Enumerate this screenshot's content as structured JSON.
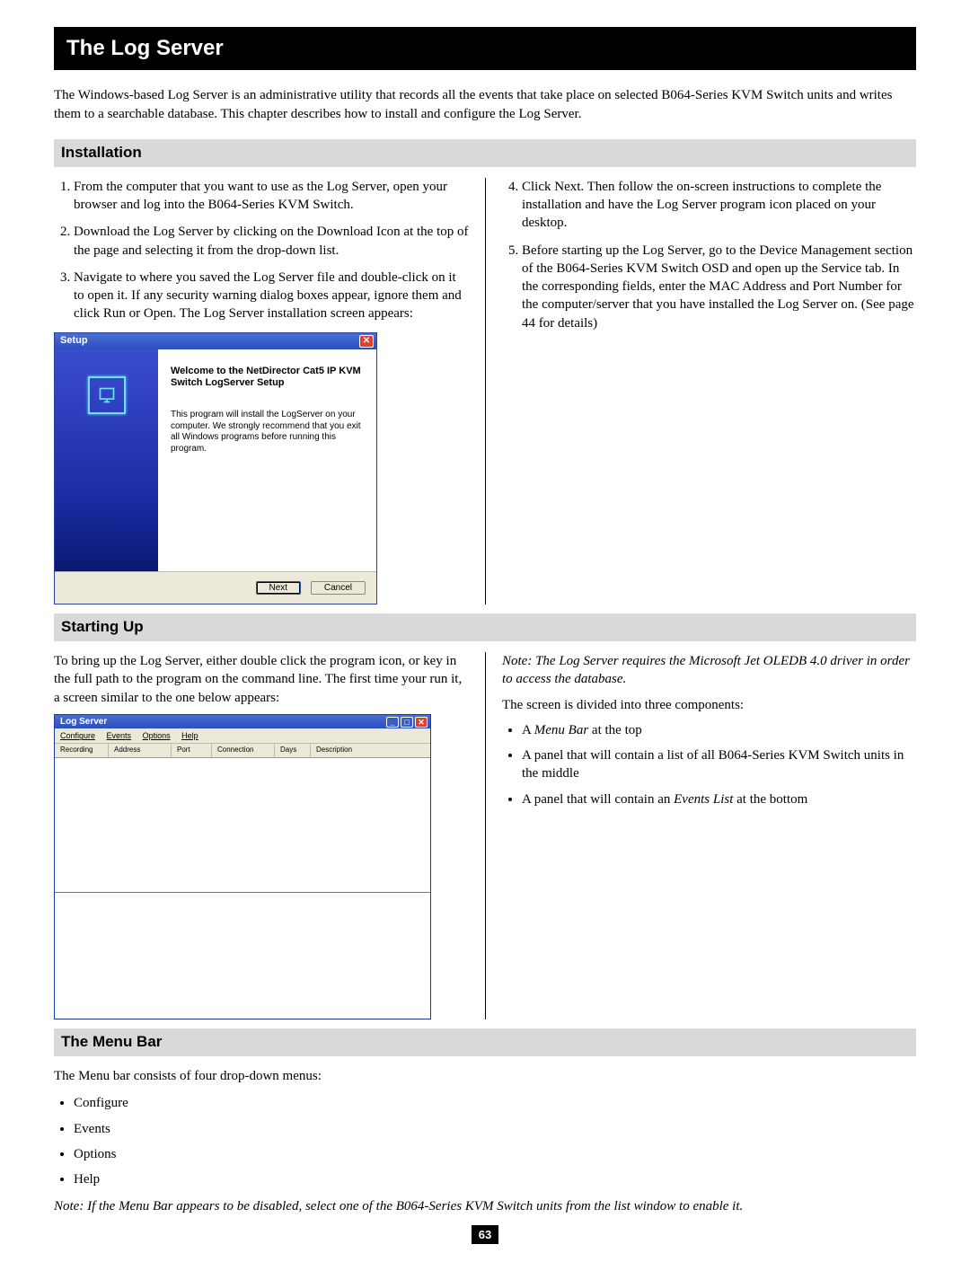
{
  "title": "The Log Server",
  "intro": "The Windows-based Log Server is an administrative utility that records all the events that take place on selected B064-Series KVM Switch units and writes them to a searchable database. This chapter describes how to install and configure the Log Server.",
  "sections": {
    "installation": {
      "heading": "Installation",
      "steps_left": [
        "From the computer that you want to use as the Log Server, open your browser and log into the B064-Series KVM Switch.",
        "Download the Log Server by clicking on the Download Icon at the top of the page and selecting it from the drop-down list.",
        "Navigate to where you saved the Log Server file and double-click on it to open it. If any security warning dialog boxes appear, ignore them and click Run or Open. The Log Server installation screen appears:"
      ],
      "steps_right": [
        "Click Next. Then follow the on-screen instructions to complete the installation and have the Log Server program icon placed on your desktop.",
        "Before starting up the Log Server, go to the Device Management section of the B064-Series KVM Switch OSD and open up the Service tab. In the corresponding fields, enter the MAC Address and Port Number for the computer/server that you have installed the Log Server on. (See page 44 for details)"
      ]
    },
    "startingUp": {
      "heading": "Starting Up",
      "left_text": "To bring up the Log Server, either double click the program icon, or key in the full path to the program on the command line. The first time your run it, a screen similar to the one below appears:",
      "right_note": "Note: The Log Server requires the Microsoft Jet OLEDB 4.0 driver in order to access the database.",
      "right_text": "The screen is divided into three components:",
      "right_bullets_pre": [
        "A ",
        "A panel that will contain a list of all B064-Series KVM Switch units in the middle",
        "A panel that will contain an "
      ],
      "right_bullets_em": [
        "Menu Bar",
        "",
        "Events List"
      ],
      "right_bullets_post": [
        " at the top",
        "",
        " at the bottom"
      ]
    },
    "menuBar": {
      "heading": "The Menu Bar",
      "lead": "The Menu bar consists of four drop-down menus:",
      "items": [
        "Configure",
        "Events",
        "Options",
        "Help"
      ],
      "note": "Note: If the Menu Bar appears to be disabled, select one of the B064-Series KVM Switch units from the list window to enable it."
    }
  },
  "setupWizard": {
    "windowTitle": "Setup",
    "welcome": "Welcome to the NetDirector Cat5 IP KVM Switch LogServer Setup",
    "body": "This program will install the LogServer on your computer. We strongly recommend that you exit all Windows programs before running this program.",
    "nextBtn": "Next",
    "cancelBtn": "Cancel"
  },
  "logServerApp": {
    "windowTitle": "Log Server",
    "menu": [
      "Configure",
      "Events",
      "Options",
      "Help"
    ],
    "columns": [
      "Recording",
      "Address",
      "Port",
      "Connection",
      "Days",
      "Description"
    ]
  },
  "pageNumber": "63"
}
